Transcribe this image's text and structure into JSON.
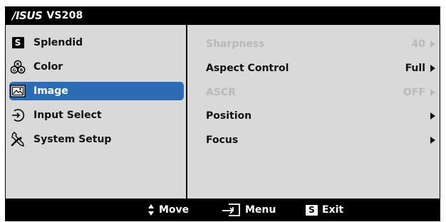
{
  "title": {
    "brand": "/ISUS",
    "model": "VS208"
  },
  "menu": [
    {
      "id": "splendid",
      "label": "Splendid",
      "icon": "splendid-s-icon"
    },
    {
      "id": "color",
      "label": "Color",
      "icon": "color-rgb-icon"
    },
    {
      "id": "image",
      "label": "Image",
      "icon": "image-icon",
      "active": true
    },
    {
      "id": "input-select",
      "label": "Input Select",
      "icon": "input-arrow-icon"
    },
    {
      "id": "system-setup",
      "label": "System Setup",
      "icon": "tools-icon"
    }
  ],
  "settings": [
    {
      "label": "Sharpness",
      "value": "40",
      "disabled": true
    },
    {
      "label": "Aspect Control",
      "value": "Full",
      "disabled": false
    },
    {
      "label": "ASCR",
      "value": "OFF",
      "disabled": true
    },
    {
      "label": "Position",
      "value": "",
      "disabled": false
    },
    {
      "label": "Focus",
      "value": "",
      "disabled": false
    }
  ],
  "footer": {
    "move_label": "Move",
    "menu_label": "Menu",
    "exit_badge": "S",
    "exit_label": "Exit"
  },
  "colors": {
    "highlight": "#2b6cb4",
    "panel": "#d9d9d9",
    "disabled": "#b9b9b9"
  }
}
